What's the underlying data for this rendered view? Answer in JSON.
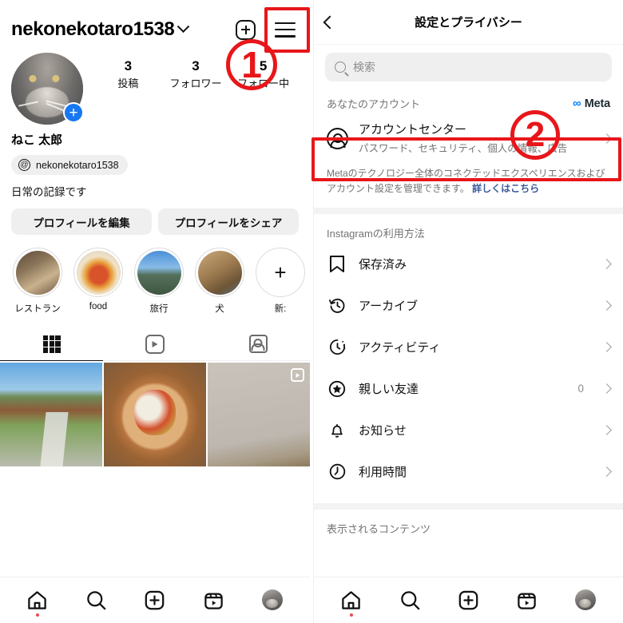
{
  "profile": {
    "username": "nekonekotaro1538",
    "chevron_icon": "chevron-down-icon",
    "add_icon": "new-post-icon",
    "menu_icon": "hamburger-menu-icon",
    "full_name": "ねこ 太郎",
    "threads_handle": "nekonekotaro1538",
    "bio": "日常の記録です",
    "stats": [
      {
        "num": "3",
        "label": "投稿"
      },
      {
        "num": "3",
        "label": "フォロワー"
      },
      {
        "num": "5",
        "label": "フォロー中"
      }
    ],
    "buttons": [
      {
        "label": "プロフィールを編集"
      },
      {
        "label": "プロフィールをシェア"
      }
    ],
    "highlights": [
      {
        "label": "レストラン"
      },
      {
        "label": "food"
      },
      {
        "label": "旅行"
      },
      {
        "label": "犬"
      },
      {
        "label": "新:"
      }
    ],
    "tabs": [
      {
        "name": "grid-tab",
        "active": true
      },
      {
        "name": "reels-tab",
        "active": false
      },
      {
        "name": "tagged-tab",
        "active": false
      }
    ]
  },
  "settings": {
    "back_icon": "back-chevron-icon",
    "title": "設定とプライバシー",
    "search_placeholder": "検索",
    "account_section": {
      "heading": "あなたのアカウント",
      "brand": "Meta",
      "row_title": "アカウントセンター",
      "row_subtitle": "パスワード、セキュリティ、個人の情報、広告",
      "description_1": "Metaのテクノロジー全体のコネクテッドエクスペリエンスおよび",
      "description_2": "アカウント設定を管理できます。",
      "learn_more": "詳しくはこちら"
    },
    "usage_section": {
      "heading": "Instagramの利用方法",
      "items": [
        {
          "icon": "bookmark-icon",
          "label": "保存済み",
          "value": ""
        },
        {
          "icon": "archive-clock-icon",
          "label": "アーカイブ",
          "value": ""
        },
        {
          "icon": "activity-icon",
          "label": "アクティビティ",
          "value": ""
        },
        {
          "icon": "close-friends-star-icon",
          "label": "親しい友達",
          "value": "0"
        },
        {
          "icon": "bell-icon",
          "label": "お知らせ",
          "value": ""
        },
        {
          "icon": "clock-icon",
          "label": "利用時間",
          "value": ""
        }
      ]
    },
    "content_section": {
      "heading": "表示されるコンテンツ"
    }
  },
  "bottom_nav": {
    "items": [
      {
        "icon": "home-icon",
        "active": true
      },
      {
        "icon": "search-icon",
        "active": false
      },
      {
        "icon": "create-icon",
        "active": false
      },
      {
        "icon": "reels-icon",
        "active": false
      },
      {
        "icon": "profile-avatar-icon",
        "active": false
      }
    ]
  },
  "annotations": {
    "accent_color": "#e8161a",
    "markers": [
      {
        "label": "1",
        "target": "hamburger-menu-button"
      },
      {
        "label": "2",
        "target": "account-center-row"
      }
    ]
  }
}
